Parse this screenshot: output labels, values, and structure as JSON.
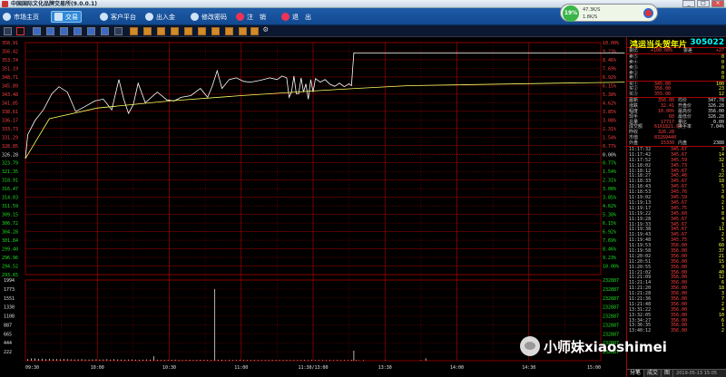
{
  "window": {
    "title": "中国国际文化品牌交易所(9.0.0.1)",
    "controls": [
      "_",
      "□",
      "×"
    ]
  },
  "menu": [
    {
      "label": "市场主页",
      "icon": "home-icon"
    },
    {
      "label": "交易",
      "icon": "trade-icon",
      "active": true
    },
    {
      "label": "客户平台",
      "icon": "client-platform-icon"
    },
    {
      "label": "出入金",
      "icon": "funds-transfer-icon"
    },
    {
      "label": "修改密码",
      "icon": "password-icon"
    },
    {
      "label": "注　销",
      "icon": "logout-icon"
    },
    {
      "label": "退　出",
      "icon": "exit-icon"
    }
  ],
  "status_widget": {
    "percent": "19%",
    "up": "47.3K/S",
    "down": "1.8K/S"
  },
  "colors": {
    "up": "#ff4040",
    "down": "#20e020",
    "grid": "#a00000",
    "price_line": "#ffffff",
    "avg_line": "#ffff60",
    "volume": "#ffffff"
  },
  "quote": {
    "name": "鸿运当头贺年片",
    "code": "305022",
    "wei": {
      "label": "委比",
      "value": "+100.00%",
      "label2": "委差",
      "value2": "+27"
    },
    "orderbook": [
      {
        "label": "卖⑤",
        "price": "",
        "vol": "0"
      },
      {
        "label": "卖④",
        "price": "",
        "vol": "0"
      },
      {
        "label": "卖③",
        "price": "",
        "vol": "0"
      },
      {
        "label": "卖②",
        "price": "",
        "vol": "0"
      },
      {
        "label": "卖①",
        "price": "",
        "vol": "0"
      },
      {
        "label": "买①",
        "price": "345.00",
        "vol": "100"
      },
      {
        "label": "买②",
        "price": "356.00",
        "vol": "23"
      },
      {
        "label": "买③",
        "price": "355.00",
        "vol": "12"
      }
    ],
    "stats": [
      {
        "l1": "最新",
        "v1": "356.00",
        "l2": "均价",
        "v2": "347.78"
      },
      {
        "l1": "涨跌",
        "v1": "32.41",
        "l2": "开盘价",
        "v2": "326.28"
      },
      {
        "l1": "幅度",
        "v1": "10.00%",
        "l2": "最高价",
        "v2": "356.00"
      },
      {
        "l1": "现手",
        "v1": "60",
        "l2": "最低价",
        "v2": "326.28"
      },
      {
        "l1": "总量",
        "v1": "17717",
        "l2": "量比",
        "v2": "0.00"
      },
      {
        "l1": "成交额",
        "v1": "6161821.64",
        "l2": "换手率",
        "v2": "7.04%"
      },
      {
        "l1": "昨收",
        "v1": "326.28",
        "l2": "",
        "v2": ""
      },
      {
        "l1": "市值",
        "v1": "83269440",
        "l2": "",
        "v2": ""
      },
      {
        "l1": "外盘",
        "v1": "15330",
        "l2": "内盘",
        "v2": "2388"
      }
    ],
    "ticks": [
      [
        "11:17:32",
        "345.67",
        "3"
      ],
      [
        "11:17:42",
        "345.67",
        "14"
      ],
      [
        "11:17:52",
        "345.59",
        "32"
      ],
      [
        "11:18:02",
        "345.73",
        "1"
      ],
      [
        "11:18:12",
        "345.67",
        "5"
      ],
      [
        "11:18:27",
        "345.46",
        "22"
      ],
      [
        "11:18:33",
        "345.67",
        "18"
      ],
      [
        "11:18:43",
        "345.67",
        "5"
      ],
      [
        "11:18:53",
        "345.76",
        "3"
      ],
      [
        "11:19:02",
        "345.59",
        "6"
      ],
      [
        "11:19:13",
        "345.67",
        "2"
      ],
      [
        "11:19:17",
        "345.75",
        "1"
      ],
      [
        "11:19:22",
        "345.60",
        "8"
      ],
      [
        "11:19:28",
        "345.67",
        "4"
      ],
      [
        "11:19:33",
        "345.67",
        "3"
      ],
      [
        "11:19:38",
        "345.67",
        "11"
      ],
      [
        "11:19:43",
        "345.67",
        "2"
      ],
      [
        "11:19:48",
        "345.75",
        "5"
      ],
      [
        "11:19:53",
        "356.00",
        "60"
      ],
      [
        "11:19:58",
        "356.00",
        "37"
      ],
      [
        "11:20:02",
        "356.00",
        "21"
      ],
      [
        "11:20:51",
        "356.00",
        "15"
      ],
      [
        "11:20:55",
        "356.00",
        "9"
      ],
      [
        "11:21:02",
        "356.00",
        "40"
      ],
      [
        "11:21:09",
        "356.00",
        "12"
      ],
      [
        "11:21:14",
        "356.00",
        "6"
      ],
      [
        "11:21:20",
        "356.00",
        "18"
      ],
      [
        "11:21:28",
        "356.00",
        "3"
      ],
      [
        "11:21:36",
        "356.00",
        "7"
      ],
      [
        "11:21:48",
        "356.00",
        "2"
      ],
      [
        "13:31:22",
        "356.00",
        "4"
      ],
      [
        "13:32:05",
        "356.00",
        "10"
      ],
      [
        "13:34:27",
        "356.00",
        "6"
      ],
      [
        "13:36:35",
        "356.00",
        "1"
      ],
      [
        "13:40:12",
        "356.00",
        "2"
      ]
    ],
    "tabs": [
      "分笔",
      "成交",
      "图"
    ],
    "tab_date": "2019-05-13 15:05"
  },
  "chart_data": {
    "type": "line",
    "prev_close": 326.28,
    "price_ylim": [
      293.65,
      358.91
    ],
    "price_ticks_left": [
      "358.91",
      "356.42",
      "353.74",
      "351.19",
      "348.71",
      "345.89",
      "343.48",
      "341.05",
      "338.61",
      "336.17",
      "333.73",
      "331.29",
      "328.85",
      "326.28",
      "323.79",
      "321.35",
      "318.91",
      "316.47",
      "314.03",
      "311.59",
      "309.15",
      "306.72",
      "304.28",
      "301.84",
      "299.40",
      "296.96",
      "294.52",
      "293.65"
    ],
    "pct_ticks_right": [
      "10.00%",
      "9.23%",
      "8.46%",
      "7.69%",
      "6.92%",
      "6.15%",
      "5.38%",
      "4.62%",
      "3.85%",
      "3.08%",
      "2.31%",
      "1.54%",
      "0.77%",
      "0.00%",
      "0.77%",
      "1.54%",
      "2.31%",
      "3.08%",
      "3.85%",
      "4.62%",
      "5.38%",
      "6.15%",
      "6.92%",
      "7.69%",
      "8.46%",
      "9.23%",
      "10.00%"
    ],
    "volume_ticks_left": [
      "1994",
      "1773",
      "1551",
      "1330",
      "1108",
      "887",
      "665",
      "444",
      "222"
    ],
    "volume_ticks_right": [
      "232887",
      "232887",
      "232887",
      "232887",
      "232887",
      "232887",
      "232887",
      "232887",
      "232887"
    ],
    "x_ticks": [
      "09:30",
      "10:00",
      "10:30",
      "11:00",
      "11:30/13:00",
      "13:30",
      "14:00",
      "14:30",
      "15:00"
    ],
    "price_series": [
      [
        0,
        326.3
      ],
      [
        2,
        333.0
      ],
      [
        8,
        337.0
      ],
      [
        15,
        340.0
      ],
      [
        22,
        344.5
      ],
      [
        28,
        346.5
      ],
      [
        35,
        345.0
      ],
      [
        42,
        339.5
      ],
      [
        50,
        341.0
      ],
      [
        58,
        342.5
      ],
      [
        65,
        343.0
      ],
      [
        72,
        340.0
      ],
      [
        78,
        348.5
      ],
      [
        82,
        343.0
      ],
      [
        86,
        339.0
      ],
      [
        90,
        341.5
      ],
      [
        94,
        347.5
      ],
      [
        100,
        342.0
      ],
      [
        110,
        345.0
      ],
      [
        118,
        342.8
      ],
      [
        124,
        342.5
      ],
      [
        130,
        343.5
      ],
      [
        138,
        344.0
      ],
      [
        146,
        346.0
      ],
      [
        152,
        343.5
      ],
      [
        156,
        346.8
      ],
      [
        160,
        351.0
      ],
      [
        164,
        346.0
      ],
      [
        170,
        348.5
      ],
      [
        176,
        349.0
      ],
      [
        182,
        348.0
      ],
      [
        188,
        347.8
      ],
      [
        196,
        348.3
      ],
      [
        204,
        349.0
      ],
      [
        210,
        348.5
      ],
      [
        214,
        349.5
      ],
      [
        218,
        349.0
      ],
      [
        220,
        343.5
      ],
      [
        222,
        345.0
      ],
      [
        224,
        349.5
      ],
      [
        226,
        344.5
      ],
      [
        228,
        344.5
      ],
      [
        230,
        349.0
      ],
      [
        232,
        345.0
      ],
      [
        234,
        347.3
      ],
      [
        236,
        343.0
      ],
      [
        238,
        348.5
      ],
      [
        240,
        345.0
      ],
      [
        242,
        348.8
      ],
      [
        246,
        347.8
      ],
      [
        250,
        348.5
      ],
      [
        254,
        347.2
      ],
      [
        258,
        346.6
      ],
      [
        262,
        347.5
      ],
      [
        266,
        346.5
      ],
      [
        270,
        347.3
      ],
      [
        272,
        346.8
      ],
      [
        274,
        356.0
      ],
      [
        340,
        356.0
      ],
      [
        500,
        356.0
      ]
    ],
    "avg_series": [
      [
        0,
        326.3
      ],
      [
        20,
        337.5
      ],
      [
        60,
        340.5
      ],
      [
        120,
        342.5
      ],
      [
        180,
        344.0
      ],
      [
        240,
        345.3
      ],
      [
        275,
        346.0
      ],
      [
        320,
        346.8
      ],
      [
        500,
        347.8
      ]
    ],
    "volume_series": [
      [
        2,
        40
      ],
      [
        5,
        55
      ],
      [
        8,
        60
      ],
      [
        11,
        45
      ],
      [
        14,
        50
      ],
      [
        17,
        40
      ],
      [
        20,
        48
      ],
      [
        23,
        38
      ],
      [
        26,
        42
      ],
      [
        29,
        36
      ],
      [
        32,
        44
      ],
      [
        35,
        40
      ],
      [
        38,
        35
      ],
      [
        41,
        30
      ],
      [
        44,
        34
      ],
      [
        47,
        38
      ],
      [
        50,
        32
      ],
      [
        53,
        28
      ],
      [
        56,
        30
      ],
      [
        59,
        34
      ],
      [
        62,
        28
      ],
      [
        65,
        30
      ],
      [
        68,
        38
      ],
      [
        71,
        26
      ],
      [
        74,
        40
      ],
      [
        77,
        30
      ],
      [
        80,
        26
      ],
      [
        83,
        24
      ],
      [
        86,
        28
      ],
      [
        89,
        30
      ],
      [
        92,
        24
      ],
      [
        95,
        22
      ],
      [
        98,
        26
      ],
      [
        101,
        30
      ],
      [
        104,
        24
      ],
      [
        107,
        110
      ],
      [
        110,
        24
      ],
      [
        113,
        20
      ],
      [
        116,
        22
      ],
      [
        119,
        20
      ],
      [
        122,
        22
      ],
      [
        125,
        24
      ],
      [
        128,
        20
      ],
      [
        131,
        18
      ],
      [
        134,
        20
      ],
      [
        137,
        22
      ],
      [
        140,
        18
      ],
      [
        143,
        20
      ],
      [
        146,
        22
      ],
      [
        149,
        18
      ],
      [
        152,
        20
      ],
      [
        155,
        16
      ],
      [
        158,
        1773
      ],
      [
        161,
        20
      ],
      [
        164,
        22
      ],
      [
        167,
        18
      ],
      [
        170,
        20
      ],
      [
        173,
        16
      ],
      [
        176,
        18
      ],
      [
        179,
        20
      ],
      [
        182,
        18
      ],
      [
        185,
        16
      ],
      [
        188,
        18
      ],
      [
        191,
        20
      ],
      [
        194,
        18
      ],
      [
        197,
        16
      ],
      [
        200,
        18
      ],
      [
        203,
        16
      ],
      [
        206,
        20
      ],
      [
        209,
        18
      ],
      [
        212,
        16
      ],
      [
        215,
        18
      ],
      [
        218,
        20
      ],
      [
        221,
        16
      ],
      [
        224,
        18
      ],
      [
        227,
        16
      ],
      [
        230,
        18
      ],
      [
        233,
        20
      ],
      [
        236,
        16
      ],
      [
        239,
        18
      ],
      [
        242,
        16
      ],
      [
        245,
        18
      ],
      [
        248,
        16
      ],
      [
        251,
        14
      ],
      [
        254,
        16
      ],
      [
        257,
        14
      ],
      [
        260,
        16
      ],
      [
        263,
        14
      ],
      [
        266,
        16
      ],
      [
        269,
        14
      ],
      [
        272,
        20
      ],
      [
        274,
        250
      ],
      [
        276,
        18
      ],
      [
        278,
        12
      ],
      [
        282,
        14
      ],
      [
        300,
        10
      ],
      [
        330,
        12
      ],
      [
        334,
        60
      ]
    ]
  },
  "watermark": "小师妹xiaoshimei"
}
